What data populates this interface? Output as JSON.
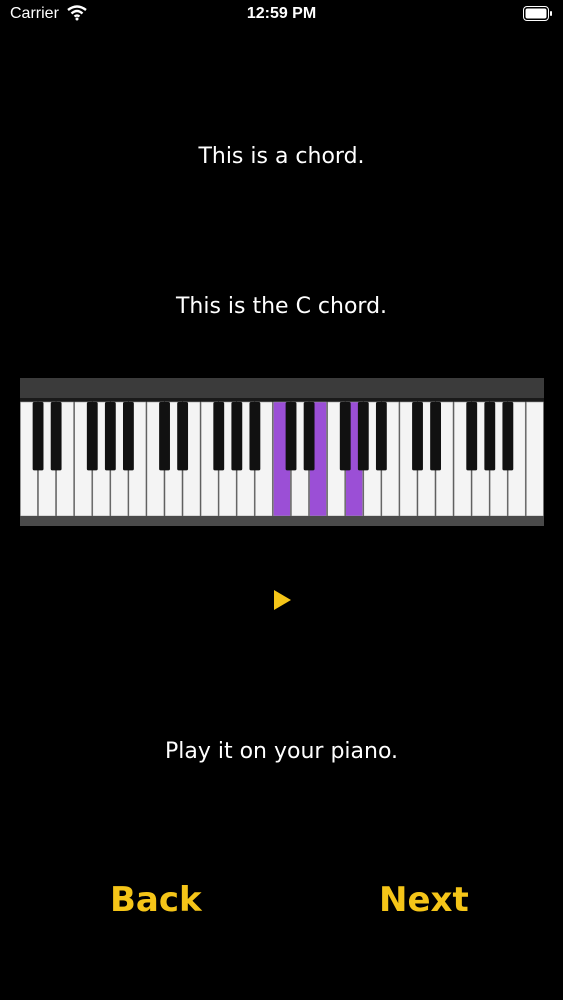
{
  "status": {
    "carrier": "Carrier",
    "time": "12:59 PM"
  },
  "lesson": {
    "line1": "This is a chord.",
    "line2": "This is the C chord.",
    "line3": "Play it on your piano."
  },
  "keyboard": {
    "white_key_count": 29,
    "highlighted_white_keys": [
      14,
      16,
      18
    ],
    "highlight_color": "#9b4fd6"
  },
  "play_icon": "play-icon",
  "accent_color": "#f5c518",
  "nav": {
    "back_label": "Back",
    "next_label": "Next"
  }
}
